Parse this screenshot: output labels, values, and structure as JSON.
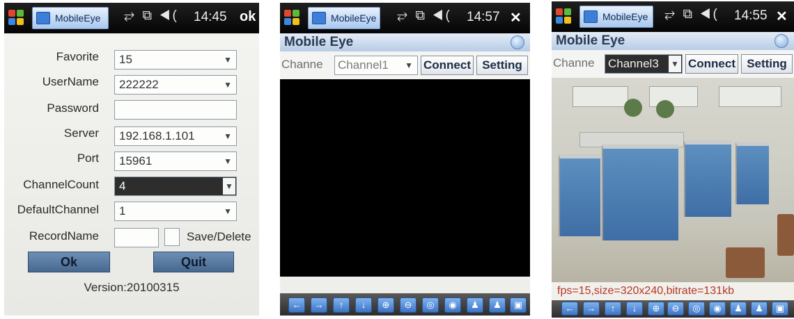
{
  "taskbar": {
    "app_name": "MobileEye",
    "status_icons": "⥂ ⧉ ◀(",
    "times": [
      "14:45",
      "14:57",
      "14:55"
    ],
    "actions": [
      "ok",
      "✕",
      "✕"
    ]
  },
  "settings": {
    "favorite_label": "Favorite",
    "favorite_value": "15",
    "username_label": "UserName",
    "username_value": "222222",
    "password_label": "Password",
    "password_value": "",
    "server_label": "Server",
    "server_value": "192.168.1.101",
    "port_label": "Port",
    "port_value": "15961",
    "channelcount_label": "ChannelCount",
    "channelcount_value": "4",
    "defaultchannel_label": "DefaultChannel",
    "defaultchannel_value": "1",
    "recordname_label": "RecordName",
    "save_delete_label": "Save/Delete",
    "ok_button": "Ok",
    "quit_button": "Quit",
    "version": "Version:20100315"
  },
  "viewer": {
    "title": "Mobile Eye",
    "channel_label": "Channe",
    "connect_button": "Connect",
    "setting_button": "Setting",
    "channel_values": [
      "Channel1",
      "Channel3"
    ],
    "stats": "fps=15,size=320x240,bitrate=131kb"
  },
  "controls": {
    "icons": [
      "left-arrow-icon",
      "right-arrow-icon",
      "up-arrow-icon",
      "down-arrow-icon",
      "zoom-in-icon",
      "zoom-out-icon",
      "focus-near-icon",
      "focus-far-icon",
      "person-icon",
      "person-alt-icon",
      "snapshot-icon"
    ],
    "glyphs": [
      "←",
      "→",
      "↑",
      "↓",
      "⊕",
      "⊖",
      "◎",
      "◉",
      "♟",
      "♟",
      "▣"
    ]
  },
  "colors": {
    "taskbar_bg": "#0a0a0a",
    "button_blue": "#5a7ea6",
    "stats_text": "#b4362b",
    "highlight": "#2d2d2d"
  }
}
